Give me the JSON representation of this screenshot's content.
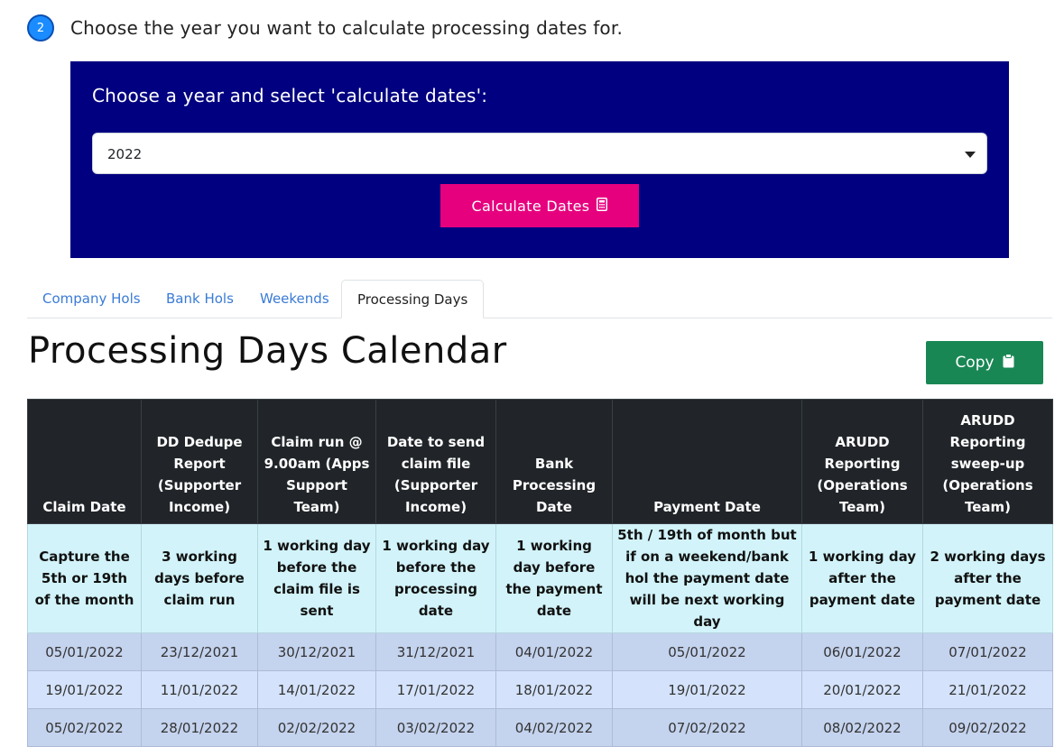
{
  "step": {
    "number": "2",
    "instruction": "Choose the year you want to calculate processing dates for."
  },
  "panel": {
    "label": "Choose a year and select 'calculate dates':",
    "year_select": {
      "value": "2022"
    },
    "calculate_button": {
      "label": "Calculate Dates",
      "icon": "calculator-icon"
    },
    "background_color": "#000080",
    "button_color": "#e6007e"
  },
  "tabs": [
    {
      "label": "Company Hols",
      "active": false
    },
    {
      "label": "Bank Hols",
      "active": false
    },
    {
      "label": "Weekends",
      "active": false
    },
    {
      "label": "Processing Days",
      "active": true
    }
  ],
  "calendar": {
    "title": "Processing Days Calendar",
    "copy_button": {
      "label": "Copy",
      "icon": "clipboard-icon",
      "color": "#198754"
    },
    "headers": [
      "Claim Date",
      "DD Dedupe Report (Supporter Income)",
      "Claim run @ 9.00am (Apps Support Team)",
      "Date to send claim file (Supporter Income)",
      "Bank Processing Date",
      "Payment Date",
      "ARUDD Reporting (Operations Team)",
      "ARUDD Reporting sweep-up (Operations Team)"
    ],
    "rules": [
      "Capture the 5th or 19th of the month",
      "3 working days before claim run",
      "1 working day before the claim file is sent",
      "1 working day before the processing date",
      "1 working day before the payment date",
      "5th / 19th of month but if on a weekend/bank hol the payment date will be next working day",
      "1 working day after the payment date",
      "2 working days after the payment date"
    ],
    "rows": [
      [
        "05/01/2022",
        "23/12/2021",
        "30/12/2021",
        "31/12/2021",
        "04/01/2022",
        "05/01/2022",
        "06/01/2022",
        "07/01/2022"
      ],
      [
        "19/01/2022",
        "11/01/2022",
        "14/01/2022",
        "17/01/2022",
        "18/01/2022",
        "19/01/2022",
        "20/01/2022",
        "21/01/2022"
      ],
      [
        "05/02/2022",
        "28/01/2022",
        "02/02/2022",
        "03/02/2022",
        "04/02/2022",
        "07/02/2022",
        "08/02/2022",
        "09/02/2022"
      ]
    ]
  }
}
